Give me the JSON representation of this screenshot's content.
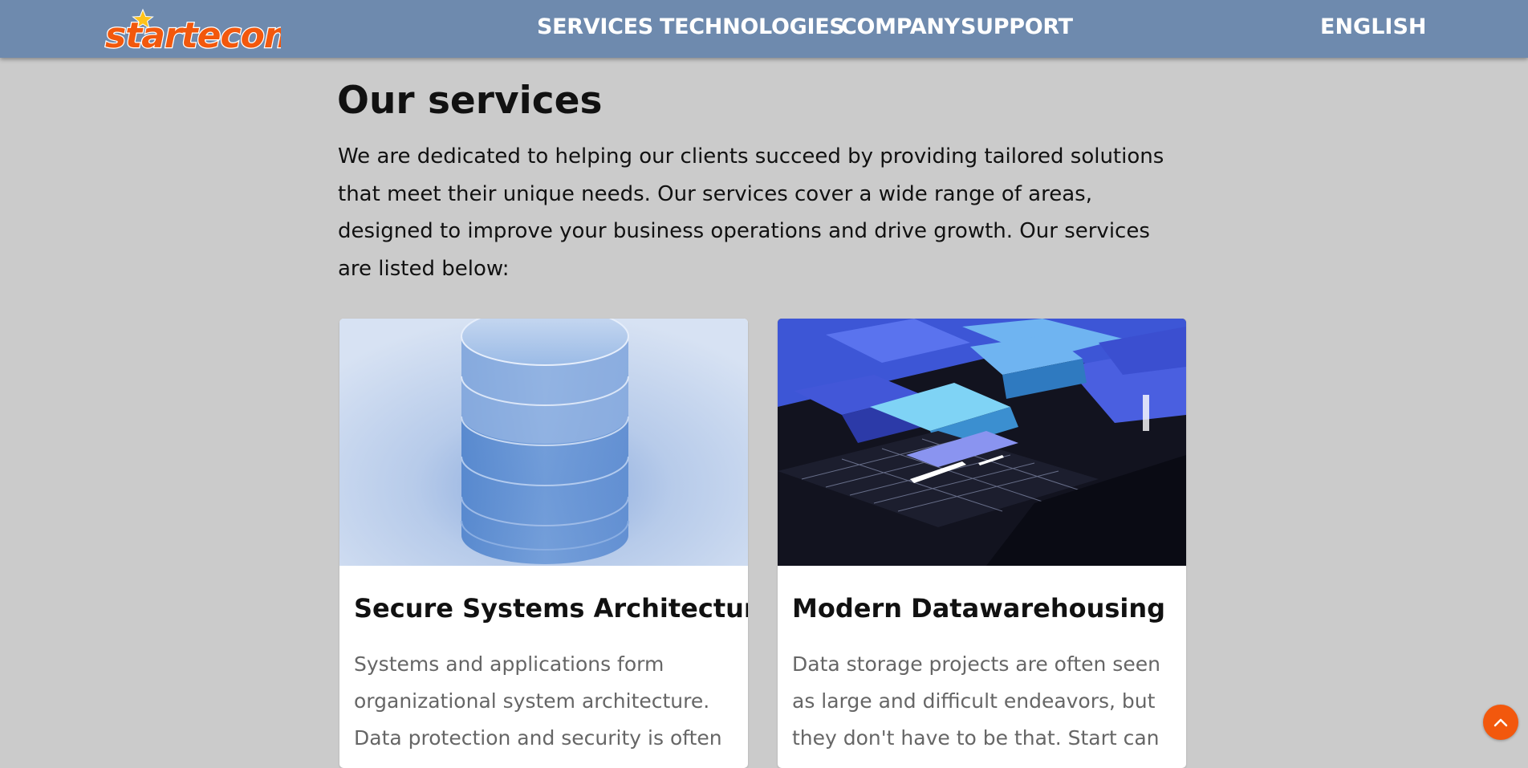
{
  "brand": {
    "logo_text": "startecon",
    "accent": "#f2580d",
    "star_color": "#ffc21a"
  },
  "nav": {
    "links": [
      "SERVICES",
      "TECHNOLOGIES",
      "COMPANY",
      "SUPPORT"
    ],
    "language": "ENGLISH",
    "background": "#6e8aae"
  },
  "main": {
    "title": "Our services",
    "intro": "We are dedicated to helping our clients succeed by providing tailored solutions that meet their unique needs. Our services cover a wide range of areas, designed to improve your business operations and drive growth. Our services are listed below:"
  },
  "cards": [
    {
      "title": "Secure Systems Architecture",
      "text": "Systems and applications form organizational system architecture. Data protection and security is often",
      "image": "database-cylinder-image"
    },
    {
      "title": "Modern Datawarehousing",
      "text": "Data storage projects are often seen as large and difficult endeavors, but they don't have to be that. Start can",
      "image": "isometric-data-blocks-image"
    }
  ],
  "scroll_top": {
    "icon": "chevron-up-icon"
  }
}
